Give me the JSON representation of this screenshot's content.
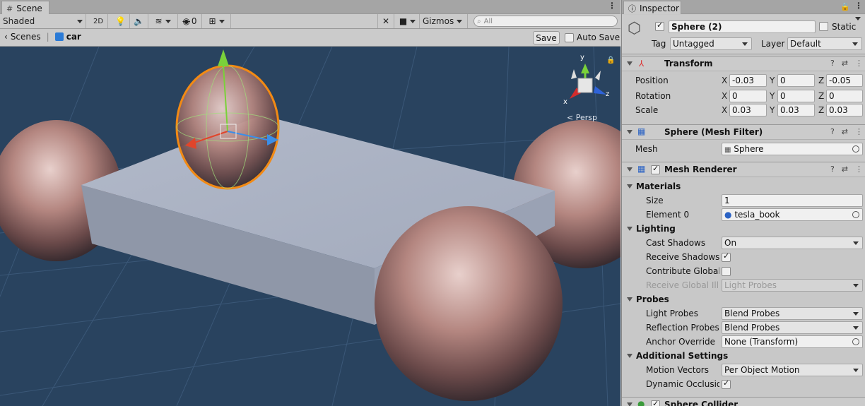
{
  "scene": {
    "tab": "Scene",
    "shading": "Shaded",
    "btn_2d": "2D",
    "hidden_count": "0",
    "gizmos": "Gizmos",
    "search_placeholder": "All",
    "breadcrumb_root": "Scenes",
    "breadcrumb_current": "car",
    "save": "Save",
    "auto_save": "Auto Save",
    "orientation": {
      "y": "y",
      "x": "x",
      "z": "z",
      "projection": "< Persp"
    }
  },
  "inspector": {
    "tab": "Inspector",
    "object_name": "Sphere (2)",
    "static_label": "Static",
    "tag_label": "Tag",
    "tag_value": "Untagged",
    "layer_label": "Layer",
    "layer_value": "Default",
    "transform": {
      "title": "Transform",
      "position_label": "Position",
      "rotation_label": "Rotation",
      "scale_label": "Scale",
      "axis_x": "X",
      "axis_y": "Y",
      "axis_z": "Z",
      "position": {
        "x": "-0.03",
        "y": "0",
        "z": "-0.05"
      },
      "rotation": {
        "x": "0",
        "y": "0",
        "z": "0"
      },
      "scale": {
        "x": "0.03",
        "y": "0.03",
        "z": "0.03"
      }
    },
    "mesh_filter": {
      "title": "Sphere (Mesh Filter)",
      "mesh_label": "Mesh",
      "mesh_value": "Sphere"
    },
    "mesh_renderer": {
      "title": "Mesh Renderer",
      "materials": "Materials",
      "size_label": "Size",
      "size_value": "1",
      "element0_label": "Element 0",
      "element0_value": "tesla_book",
      "lighting": "Lighting",
      "cast_shadows_label": "Cast Shadows",
      "cast_shadows_value": "On",
      "receive_shadows_label": "Receive Shadows",
      "contribute_gi_label": "Contribute Global I",
      "receive_gi_label": "Receive Global Illu",
      "receive_gi_value": "Light Probes",
      "probes": "Probes",
      "light_probes_label": "Light Probes",
      "light_probes_value": "Blend Probes",
      "reflection_probes_label": "Reflection Probes",
      "reflection_probes_value": "Blend Probes",
      "anchor_override_label": "Anchor Override",
      "anchor_override_value": "None (Transform)",
      "additional": "Additional Settings",
      "motion_vectors_label": "Motion Vectors",
      "motion_vectors_value": "Per Object Motion",
      "dynamic_occlusion_label": "Dynamic Occlusion"
    },
    "sphere_collider": {
      "title": "Sphere Collider"
    }
  }
}
